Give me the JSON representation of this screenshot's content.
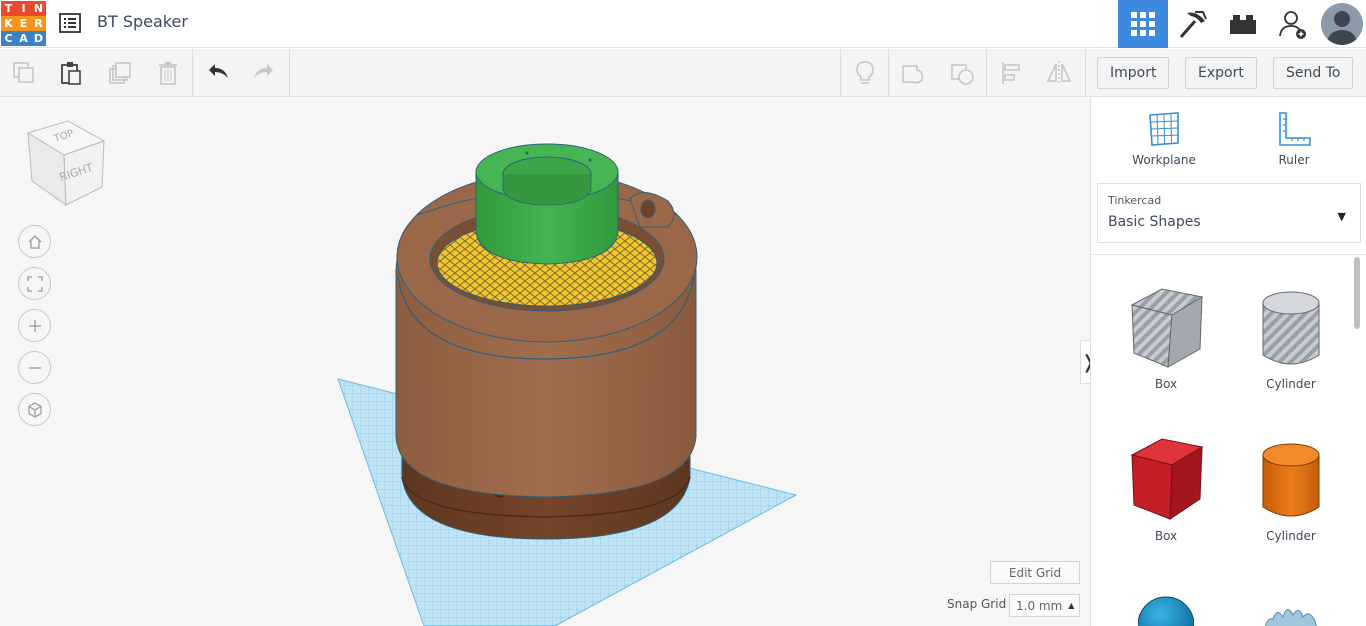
{
  "app": {
    "logo_letters": [
      "T",
      "I",
      "N",
      "K",
      "E",
      "R",
      "C",
      "A",
      "D"
    ],
    "logo_colors": [
      "#e9492f",
      "#e9492f",
      "#e9492f",
      "#f7941d",
      "#f7941d",
      "#f7941d",
      "#3b83c6",
      "#3b83c6",
      "#3b83c6"
    ],
    "document_title": "BT Speaker"
  },
  "header": {
    "buttons": [
      {
        "name": "3d-design-view",
        "icon": "grid-icon",
        "active": true
      },
      {
        "name": "codeblocks-view",
        "icon": "pickaxe-icon",
        "active": false
      },
      {
        "name": "bricks-view",
        "icon": "brick-icon",
        "active": false
      },
      {
        "name": "invite-user",
        "icon": "add-user-icon",
        "active": false
      }
    ],
    "avatar_icon": "avatar-icon"
  },
  "toolbar": {
    "icons": [
      "copy-icon",
      "paste-icon",
      "duplicate-icon",
      "delete-icon",
      "undo-icon",
      "redo-icon",
      "notes-icon",
      "group-icon",
      "ungroup-icon",
      "align-icon",
      "mirror-icon"
    ],
    "import_label": "Import",
    "export_label": "Export",
    "send_to_label": "Send To"
  },
  "viewcube": {
    "top_label": "TOP",
    "right_label": "RIGHT"
  },
  "canvas": {
    "edit_grid_label": "Edit Grid",
    "snap_grid_label": "Snap Grid",
    "snap_grid_value": "1.0 mm"
  },
  "panel": {
    "workplane_label": "Workplane",
    "ruler_label": "Ruler",
    "library_source": "Tinkercad",
    "library_name": "Basic Shapes",
    "shapes": [
      {
        "label": "Box",
        "color": "#b8bcc4",
        "kind": "box-hole"
      },
      {
        "label": "Cylinder",
        "color": "#b8bcc4",
        "kind": "cylinder-hole"
      },
      {
        "label": "Box",
        "color": "#d0202a",
        "kind": "box"
      },
      {
        "label": "Cylinder",
        "color": "#e07010",
        "kind": "cylinder"
      }
    ]
  },
  "colors": {
    "accent": "#3f88e0",
    "speaker_body": "#9b6a4a",
    "speaker_base": "#6f4126",
    "speaker_top": "#3db04b",
    "grille": "#f2c62f",
    "workplane": "#a6d8ef"
  }
}
